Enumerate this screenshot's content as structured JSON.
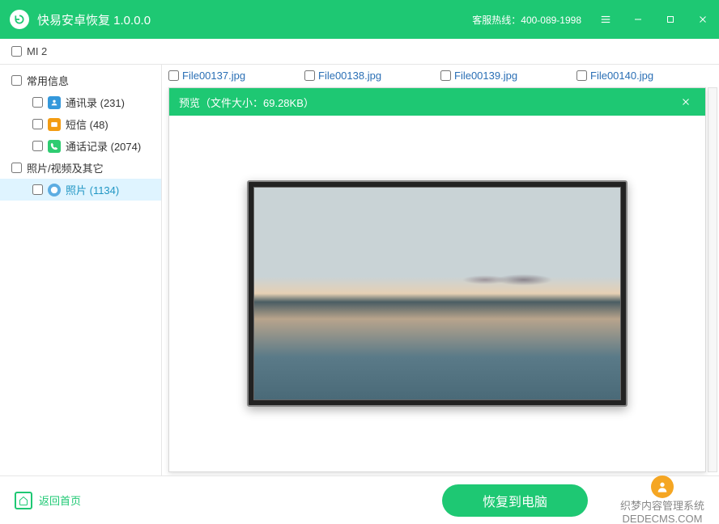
{
  "titlebar": {
    "title": "快易安卓恢复  1.0.0.0",
    "hotline": "客服热线：400-089-1998"
  },
  "device": {
    "name": "MI 2"
  },
  "sidebar": {
    "groups": [
      {
        "label": "常用信息",
        "items": [
          {
            "icon": "ic-contacts",
            "label": "通讯录 (231)"
          },
          {
            "icon": "ic-sms",
            "label": "短信 (48)"
          },
          {
            "icon": "ic-calls",
            "label": "通话记录 (2074)"
          }
        ]
      },
      {
        "label": "照片/视频及其它",
        "items": [
          {
            "icon": "ic-photos",
            "label": "照片 (1134)",
            "selected": true
          }
        ]
      }
    ]
  },
  "files": [
    {
      "name": "File00137.jpg"
    },
    {
      "name": "File00138.jpg"
    },
    {
      "name": "File00139.jpg"
    },
    {
      "name": "File00140.jpg"
    }
  ],
  "preview": {
    "title": "预览（文件大小：69.28KB）"
  },
  "footer": {
    "back": "返回首页",
    "recover": "恢复到电脑",
    "brand_line1": "织梦内容管理系统",
    "brand_line2": "DEDECMS.COM"
  }
}
